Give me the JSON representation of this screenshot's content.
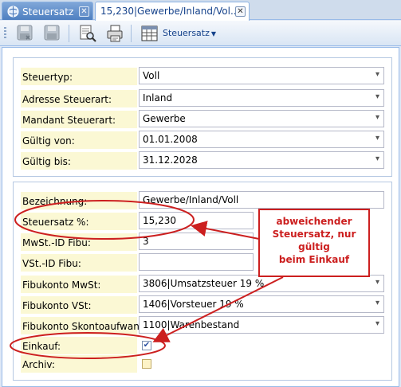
{
  "tabs": [
    {
      "label": "Steuersatz",
      "active": false
    },
    {
      "label": "15,230|Gewerbe/Inland/Vol...",
      "active": true
    }
  ],
  "toolbar": {
    "dropdown_label": "Steuersatz"
  },
  "form1": [
    {
      "label": "Steuertyp:",
      "value": "Voll"
    },
    {
      "label": "Adresse Steuerart:",
      "value": "Inland"
    },
    {
      "label": "Mandant Steuerart:",
      "value": "Gewerbe"
    },
    {
      "label": "Gültig von:",
      "value": "01.01.2008"
    },
    {
      "label": "Gültig bis:",
      "value": "31.12.2028"
    }
  ],
  "form2": {
    "bezeichnung": {
      "label": "Bezeichnung:",
      "value": "Gewerbe/Inland/Voll"
    },
    "steuersatz": {
      "label": "Steuersatz %:",
      "value": "15,230"
    },
    "mwst_id": {
      "label": "MwSt.-ID Fibu:",
      "value": "3"
    },
    "vst_id": {
      "label": "VSt.-ID Fibu:",
      "value": ""
    },
    "fibukonto_mwst": {
      "label": "Fibukonto MwSt:",
      "value": "3806|Umsatzsteuer 19 %"
    },
    "fibukonto_vst": {
      "label": "Fibukonto VSt:",
      "value": "1406|Vorsteuer 19 %"
    },
    "fibukonto_skonto": {
      "label": "Fibukonto Skontoaufwand:",
      "value": "1100|Warenbestand"
    },
    "einkauf": {
      "label": "Einkauf:",
      "checked": true
    },
    "archiv": {
      "label": "Archiv:",
      "checked": false
    }
  },
  "callout": {
    "line1": "abweichender",
    "line2": "Steuersatz, nur gültig",
    "line3": "beim Einkauf"
  },
  "colors": {
    "annotation": "#cc1f1f",
    "label_bg": "#fbf8d4",
    "accent": "#15428b"
  }
}
